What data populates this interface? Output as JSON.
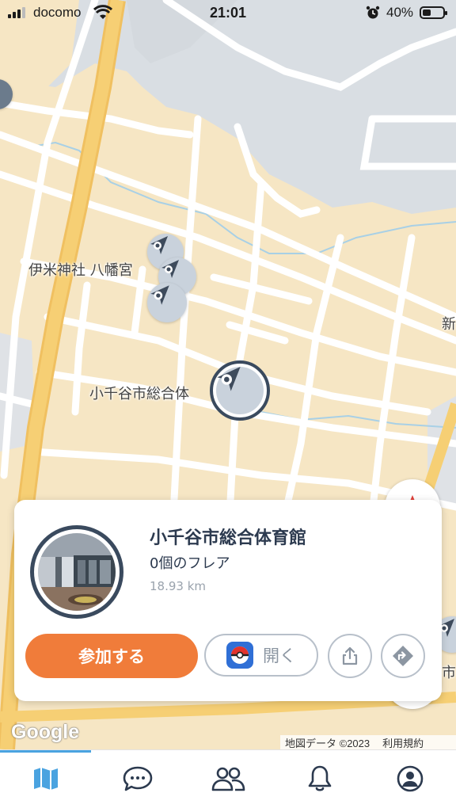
{
  "status_bar": {
    "carrier": "docomo",
    "time": "21:01",
    "battery_percent": "40%",
    "battery_level": 0.4
  },
  "map": {
    "labels": {
      "shrine": "伊米神社 八幡宮",
      "gym": "小千谷市総合体",
      "edge_right_1": "新",
      "edge_right_2": "市"
    },
    "google_logo": "Google",
    "attribution": {
      "map_data": "地図データ ©2023",
      "terms": "利用規約"
    },
    "colors": {
      "land": "#f6e6c4",
      "water": "#d9dee3",
      "major_road": "#f4c86b",
      "road": "#ffffff",
      "accent": "#f07c3a"
    }
  },
  "card": {
    "title": "小千谷市総合体育館",
    "flares": "0個のフレア",
    "distance": "18.93 km",
    "join_label": "参加する",
    "open_label": "開く"
  },
  "tabbar": {
    "items": [
      {
        "icon": "map-icon",
        "active": true
      },
      {
        "icon": "chat-icon",
        "active": false
      },
      {
        "icon": "friends-icon",
        "active": false
      },
      {
        "icon": "bell-icon",
        "active": false
      },
      {
        "icon": "profile-icon",
        "active": false
      }
    ]
  }
}
